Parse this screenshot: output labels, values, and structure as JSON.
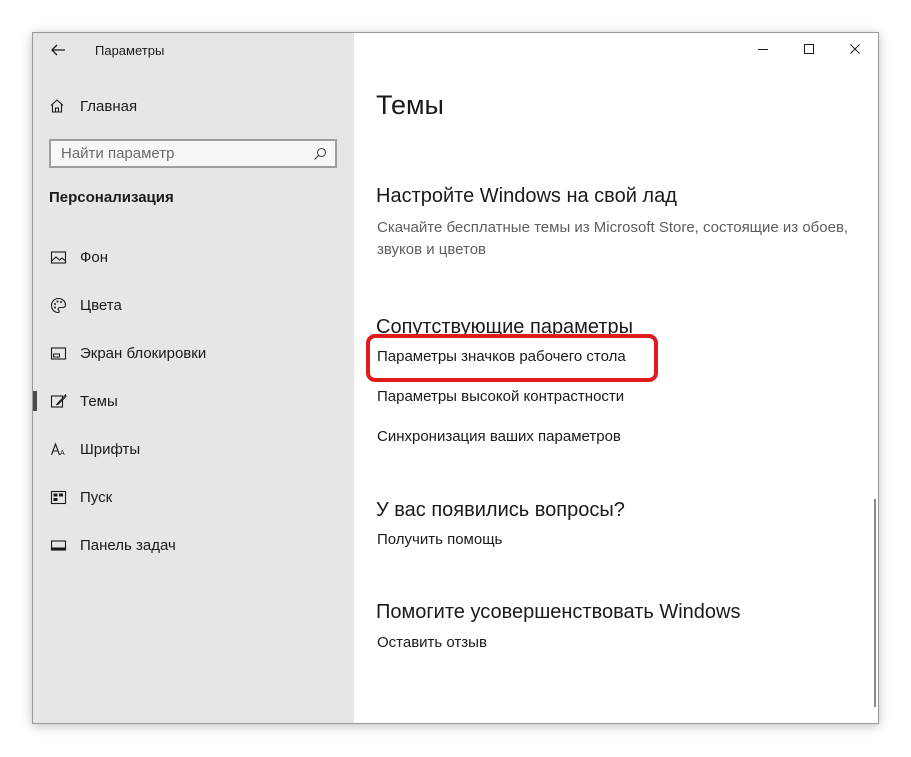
{
  "window": {
    "title": "Параметры"
  },
  "sidebar": {
    "home_label": "Главная",
    "search_placeholder": "Найти параметр",
    "section_title": "Персонализация",
    "items": [
      {
        "label": "Фон",
        "icon": "image-icon",
        "active": false
      },
      {
        "label": "Цвета",
        "icon": "palette-icon",
        "active": false
      },
      {
        "label": "Экран блокировки",
        "icon": "lock-screen-icon",
        "active": false
      },
      {
        "label": "Темы",
        "icon": "themes-icon",
        "active": true
      },
      {
        "label": "Шрифты",
        "icon": "font-icon",
        "active": false
      },
      {
        "label": "Пуск",
        "icon": "start-icon",
        "active": false
      },
      {
        "label": "Панель задач",
        "icon": "taskbar-icon",
        "active": false
      }
    ]
  },
  "main": {
    "title": "Темы",
    "customize": {
      "heading": "Настройте Windows на свой лад",
      "description": "Скачайте бесплатные темы из Microsoft Store, состоящие из обоев, звуков и цветов"
    },
    "related": {
      "heading": "Сопутствующие параметры",
      "links": [
        "Параметры значков рабочего стола",
        "Параметры высокой контрастности",
        "Синхронизация ваших параметров"
      ]
    },
    "questions": {
      "heading": "У вас появились вопросы?",
      "link": "Получить помощь"
    },
    "improve": {
      "heading": "Помогите усовершенствовать Windows",
      "link": "Оставить отзыв"
    }
  },
  "colors": {
    "sidebar_bg": "#e6e6e6",
    "highlight": "#e21c1c",
    "text": "#1a1a1a",
    "muted": "#5e5e5e"
  }
}
